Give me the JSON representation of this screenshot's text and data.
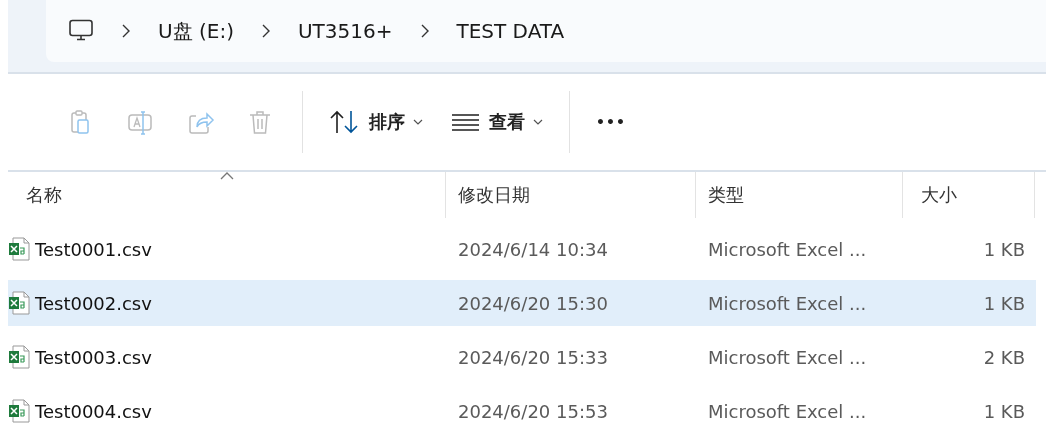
{
  "breadcrumb": [
    {
      "kind": "computer"
    },
    {
      "label": "U盘 (E:)"
    },
    {
      "label": "UT3516+"
    },
    {
      "label": "TEST DATA"
    }
  ],
  "toolbar": {
    "actions": [
      {
        "kind": "paste",
        "disabled": true
      },
      {
        "kind": "rename",
        "disabled": true
      },
      {
        "kind": "share",
        "disabled": true
      },
      {
        "kind": "delete",
        "disabled": true
      }
    ],
    "sort": {
      "label": "排序"
    },
    "view": {
      "label": "查看"
    },
    "more": {
      "label": "•••"
    }
  },
  "table": {
    "columns": [
      {
        "label": "名称",
        "sorted": true
      },
      {
        "label": "修改日期",
        "sorted": false
      },
      {
        "label": "类型",
        "sorted": false
      },
      {
        "label": "大小",
        "sorted": false
      }
    ],
    "rows": [
      {
        "name": "Test0001.csv",
        "modified": "2024/6/14 10:34",
        "type": "Microsoft Excel ...",
        "size": "1 KB",
        "selected": false
      },
      {
        "name": "Test0002.csv",
        "modified": "2024/6/20 15:30",
        "type": "Microsoft Excel ...",
        "size": "1 KB",
        "selected": true
      },
      {
        "name": "Test0003.csv",
        "modified": "2024/6/20 15:33",
        "type": "Microsoft Excel ...",
        "size": "2 KB",
        "selected": false
      },
      {
        "name": "Test0004.csv",
        "modified": "2024/6/20 15:53",
        "type": "Microsoft Excel ...",
        "size": "1 KB",
        "selected": false
      }
    ]
  }
}
